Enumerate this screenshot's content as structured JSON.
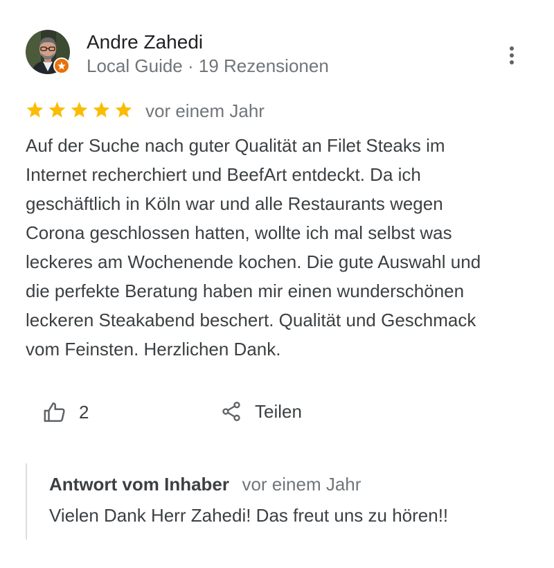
{
  "reviewer": {
    "name": "Andre Zahedi",
    "meta": "Local Guide · 19 Rezensionen",
    "avatar_icon": "profile-photo",
    "badge_icon": "local-guide-star-badge",
    "badge_color": "#e8710a"
  },
  "rating": {
    "stars": 5,
    "max": 5,
    "star_color": "#fbbc04",
    "date": "vor einem Jahr"
  },
  "review": {
    "lines": [
      "Auf der Suche nach guter Qualität an Filet Steaks im",
      "Internet recherchiert und BeefArt entdeckt. Da ich",
      "geschäftlich in Köln war und alle Restaurants wegen",
      "Corona geschlossen hatten, wollte ich mal selbst was",
      "leckeres am Wochenende kochen. Die gute Auswahl und",
      "die perfekte Beratung haben mir einen wunderschönen",
      "leckeren Steakabend beschert. Qualität und Geschmack",
      "vom Feinsten. Herzlichen Dank."
    ]
  },
  "actions": {
    "like_count": "2",
    "like_icon": "thumbs-up-icon",
    "share_label": "Teilen",
    "share_icon": "share-icon",
    "more_icon": "more-vert-icon"
  },
  "owner_response": {
    "title": "Antwort vom Inhaber",
    "date": "vor einem Jahr",
    "text": "Vielen Dank Herr Zahedi! Das freut uns zu hören!!"
  }
}
